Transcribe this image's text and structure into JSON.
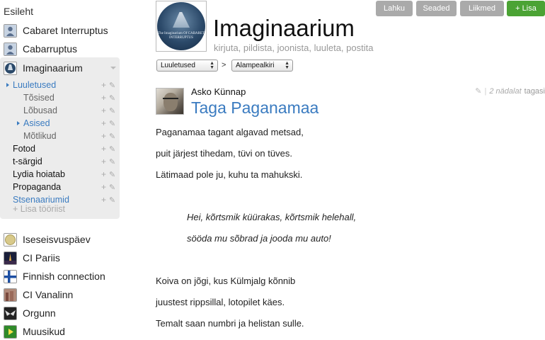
{
  "sidebar": {
    "home_label": "Esileht",
    "groups": [
      {
        "label": "Cabaret Interruptus"
      },
      {
        "label": "Cabarruptus"
      },
      {
        "label": "Imaginaarium",
        "selected": true
      }
    ],
    "tree": [
      {
        "label": "Luuletused",
        "color": "blue",
        "arrow": true,
        "indent": 0
      },
      {
        "label": "Tõsised",
        "color": "muted",
        "arrow": false,
        "indent": 2
      },
      {
        "label": "Lõbusad",
        "color": "muted",
        "arrow": false,
        "indent": 2
      },
      {
        "label": "Asised",
        "color": "blue",
        "arrow": true,
        "indent": 1
      },
      {
        "label": "Mõtlikud",
        "color": "muted",
        "arrow": false,
        "indent": 2
      },
      {
        "label": "Fotod",
        "color": "dark",
        "arrow": false,
        "indent": 0
      },
      {
        "label": "t-särgid",
        "color": "dark",
        "arrow": false,
        "indent": 0
      },
      {
        "label": "Lydia hoiatab",
        "color": "dark",
        "arrow": false,
        "indent": 0
      },
      {
        "label": "Propaganda",
        "color": "dark",
        "arrow": false,
        "indent": 0
      },
      {
        "label": "Stsenaariumid",
        "color": "blue",
        "arrow": false,
        "indent": 0
      }
    ],
    "tree_plus": "+",
    "tree_edit": "✎",
    "add_tool": "+ Lisa tööriist",
    "communities": [
      {
        "label": "Iseseisvuspäev",
        "icon": "coin-icon"
      },
      {
        "label": "CI Pariis",
        "icon": "night-city-icon"
      },
      {
        "label": "Finnish connection",
        "icon": "finnish-flag-icon"
      },
      {
        "label": "CI Vanalinn",
        "icon": "old-town-icon"
      },
      {
        "label": "Orgunn",
        "icon": "wings-icon"
      },
      {
        "label": "Muusikud",
        "icon": "play-icon"
      }
    ]
  },
  "header": {
    "title": "Imaginaarium",
    "subtitle": "kirjuta, pildista, joonista, luuleta, postita",
    "logo_text": "The Imaginarium Of CABARET INTERRUPTUS",
    "buttons": {
      "leave": "Lahku",
      "settings": "Seaded",
      "members": "Liikmed",
      "add": "+ Lisa"
    },
    "breadcrumb": {
      "first": "Luuletused",
      "separator": ">",
      "second": "Alampealkiri"
    }
  },
  "post": {
    "author": "Asko Künnap",
    "title": "Taga Paganamaa",
    "separator": "|",
    "time": "2 nädalat",
    "time_suffix": "tagasi",
    "lines": [
      "Paganamaa tagant algavad metsad,",
      "puit järjest tihedam, tüvi on tüves.",
      "Lätimaad pole ju, kuhu ta mahukski."
    ],
    "italic_lines": [
      "Hei, kõrtsmik küürakas, kõrtsmik helehall,",
      "sööda mu sõbrad ja jooda mu auto!"
    ],
    "lines_after": [
      "Koiva on jõgi, kus Külmjalg kõnnib",
      "juustest rippsillal, lotopilet käes.",
      "Temalt saan numbri ja helistan sulle."
    ]
  },
  "colors": {
    "accent_blue": "#3a7bc0",
    "add_green": "#4ba334",
    "button_grey": "#aaaaaa",
    "selected_bg": "#ececec"
  }
}
